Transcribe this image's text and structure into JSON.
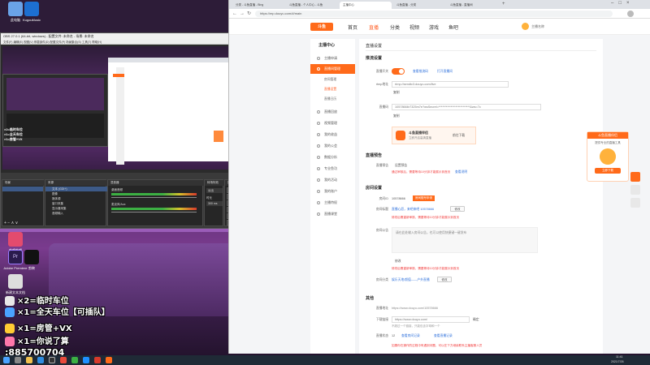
{
  "desktop": {
    "icons": [
      {
        "name": "此电脑",
        "color": "#6aa3e8"
      },
      {
        "name": "KugouMusic",
        "color": "#1d6fd1"
      },
      {
        "name": "哔哩哔哩",
        "color": "#e34b6e"
      },
      {
        "name": "Adobe Premiere",
        "color": "#2a1b4d"
      },
      {
        "name": "剪映",
        "color": "#111111"
      },
      {
        "name": "新建文本文档",
        "color": "#dddddd"
      }
    ],
    "overlay_lines": [
      "×2=临时车位",
      "×1=全天车位【可插队】",
      "×1=房管+VX",
      "×1=你说了算",
      ":885700704"
    ]
  },
  "obs": {
    "title": "OBS 27.0.1 (64-bit, windows) - 配置文件: 未命名 - 场景: 未命名",
    "menu": "文件(F)  编辑(E)  视图(V)  停靠部件(D)  配置文件(P)  场景集合(S)  工具(T)  帮助(H)",
    "docks": {
      "scenes": "场景",
      "sources": "来源",
      "mixer": "混音器",
      "transitions": "转场特效",
      "controls": "控件"
    },
    "sources": [
      "文本 (GDI+)",
      "图像",
      "媒体源",
      "窗口采集",
      "显示器采集",
      "音频输入"
    ],
    "mixer_tracks": [
      "桌面音频",
      "麦克风/Aux"
    ],
    "transition_value": "淡出",
    "duration_label": "时长",
    "duration_value": "300 ms",
    "controls": [
      "开始推流",
      "开始录制",
      "启动虚拟摄像机",
      "工作室模式",
      "设置",
      "退出"
    ]
  },
  "browser": {
    "tabs": [
      "分类 - 斗鱼直播 - Bing",
      "斗鱼直播 - 个人中心 - 斗鱼",
      "主播中心",
      "斗鱼直播 - 分类",
      "斗鱼直播 - 直播间"
    ],
    "url": "https://mp.douyu.com/#/main",
    "site": {
      "logo": "斗鱼",
      "nav": [
        "首页",
        "直播",
        "分类",
        "视频",
        "游戏",
        "鱼吧"
      ],
      "nav_active": 1,
      "user": "主播名称"
    },
    "sidebar": {
      "title": "主播中心",
      "items": [
        {
          "label": "主播申请"
        },
        {
          "label": "直播间管理",
          "on": true
        },
        {
          "label": "直播回放"
        },
        {
          "label": "视频管理"
        },
        {
          "label": "我的收益"
        },
        {
          "label": "我的公会"
        },
        {
          "label": "数据分析"
        },
        {
          "label": "专业鱼功"
        },
        {
          "label": "我的活动"
        },
        {
          "label": "我的账户"
        },
        {
          "label": "主播特权"
        },
        {
          "label": "直播课堂"
        }
      ],
      "subs": [
        "房间管理",
        "直播设置",
        "直播日历"
      ]
    },
    "main": {
      "page_title": "直播设置",
      "push": {
        "title": "推流设置",
        "live_label": "直播开关",
        "btn_copy_addr": "查看推流码",
        "btn_open_room": "打开直播间",
        "rtmp_label": "rtmp地址",
        "rtmp_value": "rtmp://sendtc3.douyu.com/live",
        "copy": "复制",
        "code_label": "直播码",
        "code_value": "10578666r7325m7e?wsSecret=**************************&ws=7c",
        "copy2": "复制",
        "promo_title": "斗鱼直播伴侣",
        "promo_sub": "立即开启高清直播",
        "promo_btn": "前往下载"
      },
      "notice": {
        "title": "直播预告",
        "label": "直播预告",
        "btn": "设置预告",
        "tip": "通过审核后，需要等待10分钟才能展示到首页",
        "link": "查看说明"
      },
      "room": {
        "title": "房间设置",
        "id_label": "房间ID",
        "id_value": "10578666",
        "id_btn": "房间靓号申请",
        "name_label": "房间标题",
        "name_link": "直播心愿，来吧来吧 10578666",
        "name_btn": "修改",
        "name_tip": "修改后需重新审核，需要等待10分钟才能展示到首页",
        "intro_label": "房间公告",
        "intro_value": "请在此处输入房间公告，也可以使用快捷键一键发布",
        "intro_btn": "修改",
        "intro_tip": "修改后需重新审核，需要等待10分钟才能展示到首页",
        "cat_label": "房间分类",
        "cat_link": "娱乐天地/颜值——户外直播",
        "cat_btn": "修改"
      },
      "other": {
        "title": "其他",
        "addr_label": "直播地址",
        "addr_value": "https://www.douyu.com/10578666",
        "dl_label": "下载链接",
        "dl_value": "https://www.douyu.com/",
        "dl_btn": "确定",
        "dl_tip": "不超过一个链接，只能包含字母和一个",
        "stat_label": "直播状态",
        "stat_value": "12",
        "stat_link1": "查看房间记录",
        "stat_link2": "查看直播记录",
        "footer_tip": "如果你在操作的过程中有遇到问题，可以在下方继续联系主播客服人员"
      },
      "side_ad": {
        "title": "斗鱼直播伴侣",
        "sub": "提供专业的直播工具",
        "btn": "立即下载"
      }
    }
  },
  "taskbar": {
    "time": "11:41",
    "date": "2021/7/26",
    "apps": [
      "开始",
      "搜索",
      "文件管理器",
      "Edge",
      "OBS",
      "Chrome",
      "微信",
      "QQ",
      "网易云音乐",
      "直播伴侣"
    ]
  }
}
